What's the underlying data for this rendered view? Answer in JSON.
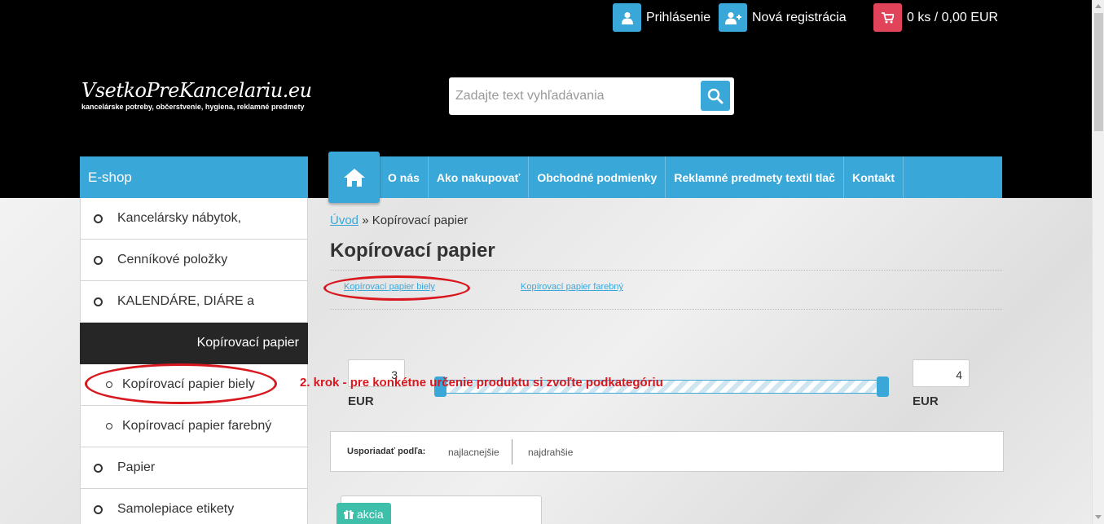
{
  "topbar": {
    "login_label": "Prihlásenie",
    "register_label": "Nová registrácia",
    "cart_label": "0 ks / 0,00 EUR"
  },
  "logo": {
    "title": "VsetkoPreKancelariu.eu",
    "subtitle": "kancelárske potreby, občerstvenie, hygiena, reklamné predmety"
  },
  "search": {
    "placeholder": "Zadajte text vyhľadávania"
  },
  "eshop_title": "E-shop",
  "nav": {
    "items": [
      "O nás",
      "Ako nakupovať",
      "Obchodné podmienky",
      "Reklamné predmety textil tlač",
      "Kontakt"
    ]
  },
  "sidebar": {
    "items": [
      {
        "label": "Kancelársky nábytok,"
      },
      {
        "label": "Cenníkové položky"
      },
      {
        "label": "KALENDÁRE, DIÁRE a"
      },
      {
        "label": "Kopírovací papier"
      },
      {
        "label": "Kopírovací papier biely"
      },
      {
        "label": "Kopírovací papier farebný"
      },
      {
        "label": "Papier"
      },
      {
        "label": "Samolepiace etikety"
      }
    ]
  },
  "breadcrumb": {
    "home": "Úvod",
    "separator": "»",
    "current": "Kopírovací papier"
  },
  "page_title": "Kopírovací papier",
  "subcategories": [
    "Kopírovací papier biely",
    "Kopírovací papier farebný"
  ],
  "price_filter": {
    "min_value": "3",
    "max_value": "4",
    "currency": "EUR"
  },
  "annotation": "2. krok - pre konkétne určenie produktu si zvoľte podkategóriu",
  "sort": {
    "label": "Usporiadať podľa:",
    "options": [
      "najlacnejšie",
      "najdrahšie"
    ]
  },
  "product": {
    "badge": "akcia"
  },
  "colors": {
    "accent": "#3aa7d9",
    "cart": "#e0435a",
    "annotation": "#d8181e",
    "badge": "#3dbfa9"
  }
}
